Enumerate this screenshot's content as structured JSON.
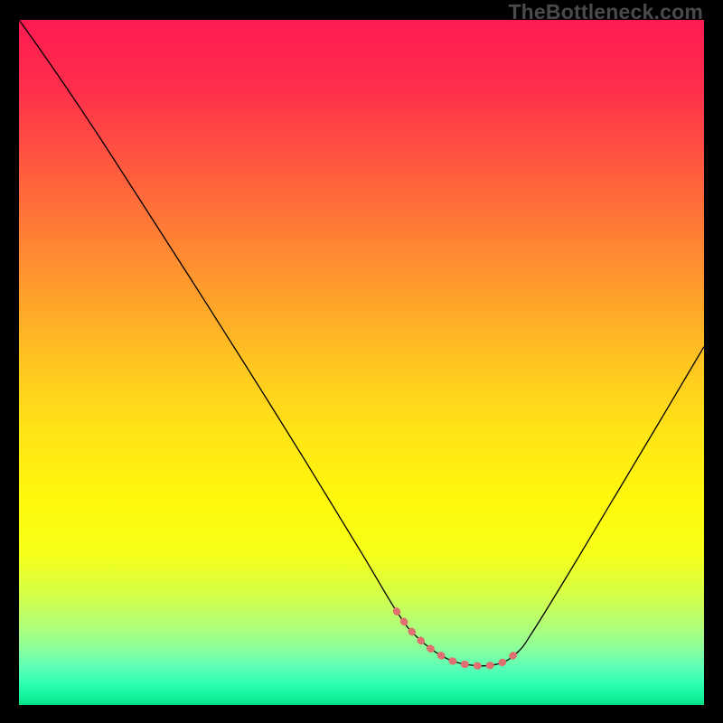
{
  "watermark": "TheBottleneck.com",
  "chart_data": {
    "type": "line",
    "title": "",
    "xlabel": "",
    "ylabel": "",
    "xlim": [
      0,
      100
    ],
    "ylim": [
      0,
      100
    ],
    "background_gradient": {
      "stops": [
        {
          "offset": 0.0,
          "color": "#ff1a52"
        },
        {
          "offset": 0.1,
          "color": "#ff2e4b"
        },
        {
          "offset": 0.2,
          "color": "#ff5440"
        },
        {
          "offset": 0.3,
          "color": "#ff7a36"
        },
        {
          "offset": 0.4,
          "color": "#ff9f2b"
        },
        {
          "offset": 0.5,
          "color": "#ffc521"
        },
        {
          "offset": 0.6,
          "color": "#ffe416"
        },
        {
          "offset": 0.7,
          "color": "#fff80c"
        },
        {
          "offset": 0.78,
          "color": "#f6ff18"
        },
        {
          "offset": 0.84,
          "color": "#d4ff49"
        },
        {
          "offset": 0.885,
          "color": "#b1ff78"
        },
        {
          "offset": 0.918,
          "color": "#8aff9b"
        },
        {
          "offset": 0.945,
          "color": "#5cffb5"
        },
        {
          "offset": 0.968,
          "color": "#2fffb3"
        },
        {
          "offset": 0.986,
          "color": "#14f59c"
        },
        {
          "offset": 1.0,
          "color": "#09e08a"
        }
      ]
    },
    "series": [
      {
        "name": "bottleneck-curve",
        "stroke": "#000000",
        "stroke_width": 1.3,
        "x": [
          0.0,
          3.0,
          7.0,
          12.0,
          18.0,
          25.0,
          33.0,
          42.0,
          50.0,
          55.1,
          58.0,
          62.0,
          66.0,
          70.0,
          72.8,
          75.0,
          80.0,
          86.0,
          93.0,
          100.0
        ],
        "values": [
          100.0,
          95.8,
          90.0,
          82.5,
          73.2,
          62.3,
          49.7,
          35.3,
          22.2,
          13.7,
          10.0,
          7.0,
          5.8,
          6.0,
          7.7,
          10.7,
          18.8,
          28.8,
          40.5,
          52.3
        ]
      },
      {
        "name": "optimal-range-highlight",
        "stroke": "#e07070",
        "stroke_width": 8,
        "linecap": "round",
        "x": [
          55.1,
          58.0,
          62.0,
          66.0,
          70.0,
          72.8
        ],
        "values": [
          13.7,
          10.0,
          7.0,
          5.8,
          6.0,
          7.7
        ]
      }
    ]
  }
}
